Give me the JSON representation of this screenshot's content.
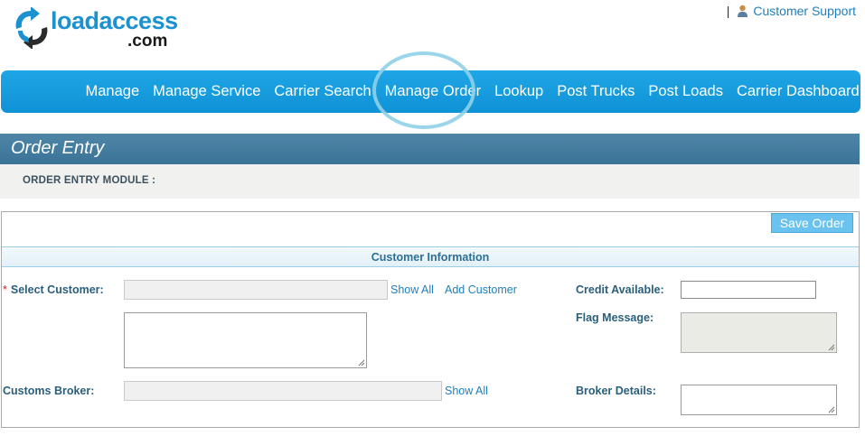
{
  "brand": {
    "word": "loadaccess",
    "suffix": ".com",
    "logo_icon": "arrows-cycle-icon"
  },
  "header": {
    "separator": "|",
    "support_link": "Customer Support",
    "support_icon": "person-icon"
  },
  "nav": {
    "items": [
      "Manage",
      "Manage Service",
      "Carrier Search",
      "Manage Order",
      "Lookup",
      "Post Trucks",
      "Post Loads",
      "Carrier Dashboard"
    ],
    "highlighted": "Manage Order"
  },
  "page": {
    "title": "Order Entry",
    "module_label": "ORDER ENTRY MODULE :"
  },
  "form": {
    "save_label": "Save Order",
    "section_title": "Customer Information",
    "required_mark": "*",
    "select_customer_label": "Select Customer:",
    "show_all_label": "Show All",
    "add_customer_label": "Add Customer",
    "credit_available_label": "Credit Available:",
    "flag_message_label": "Flag Message:",
    "customs_broker_label": "Customs Broker:",
    "broker_show_all_label": "Show All",
    "broker_details_label": "Broker Details:"
  },
  "colors": {
    "brand_blue": "#1c91cf",
    "nav_blue": "#1a9fe0",
    "header_blue": "#4a82a5",
    "link_blue": "#1c7fc0",
    "required_red": "#d02020"
  }
}
